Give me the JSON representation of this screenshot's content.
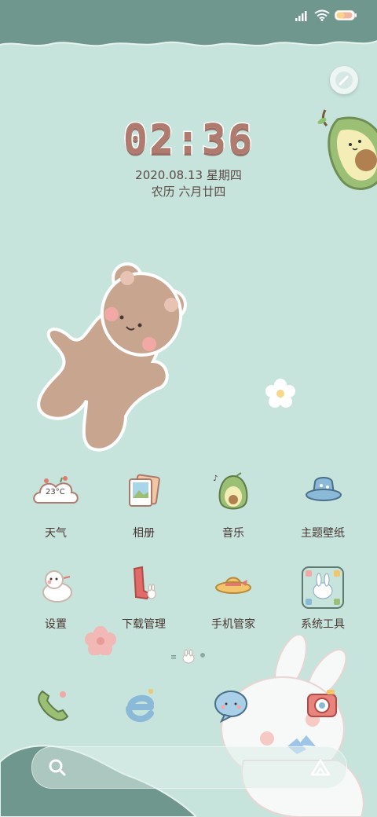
{
  "status_bar": {
    "signal_icon": "signal-bars-icon",
    "wifi_icon": "wifi-icon",
    "battery_icon": "battery-icon",
    "battery_color": "#f2b5a0"
  },
  "clock": {
    "time": "02:36",
    "date": "2020.08.13 星期四",
    "lunar": "农历 六月廿四"
  },
  "apps_row1": [
    {
      "label": "天气",
      "icon": "weather-cloud-icon",
      "temp": "23°C"
    },
    {
      "label": "相册",
      "icon": "photo-album-icon"
    },
    {
      "label": "音乐",
      "icon": "avocado-music-icon"
    },
    {
      "label": "主题壁纸",
      "icon": "bucket-hat-icon"
    }
  ],
  "apps_row2": [
    {
      "label": "设置",
      "icon": "snowman-settings-icon"
    },
    {
      "label": "下载管理",
      "icon": "download-boot-icon"
    },
    {
      "label": "手机管家",
      "icon": "straw-hat-icon"
    },
    {
      "label": "系统工具",
      "icon": "bunny-folder-icon"
    }
  ],
  "dock": [
    {
      "name": "phone",
      "icon": "phone-icon"
    },
    {
      "name": "browser",
      "icon": "browser-e-icon"
    },
    {
      "name": "messages",
      "icon": "chat-bubble-icon"
    },
    {
      "name": "camera",
      "icon": "camera-icon"
    }
  ],
  "search": {
    "icon": "search-icon",
    "assistant_icon": "triangle-assistant-icon"
  },
  "colors": {
    "background": "#c6e3dc",
    "top_band": "#6f978d",
    "clock_text": "#b07b6f"
  }
}
